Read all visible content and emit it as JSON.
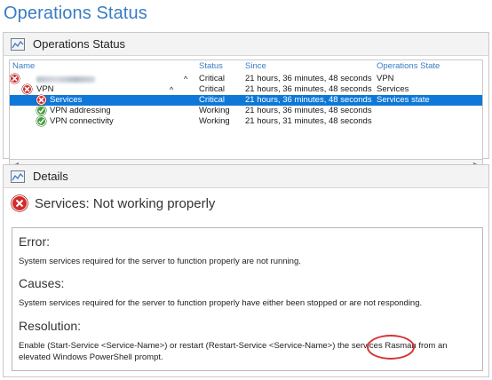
{
  "page": {
    "title": "Operations Status"
  },
  "operations_panel": {
    "title": "Operations Status",
    "columns": {
      "name": "Name",
      "status": "Status",
      "since": "Since",
      "state": "Operations State"
    },
    "rows": [
      {
        "name": "",
        "status": "Critical",
        "since": "21 hours, 36 minutes, 48 seconds",
        "state": "VPN",
        "icon": "error-icon"
      },
      {
        "name": "VPN",
        "status": "Critical",
        "since": "21 hours, 36 minutes, 48 seconds",
        "state": "Services",
        "icon": "error-icon"
      },
      {
        "name": "Services",
        "status": "Critical",
        "since": "21 hours, 36 minutes, 48 seconds",
        "state": "Services state",
        "icon": "error-icon",
        "selected": true
      },
      {
        "name": "VPN addressing",
        "status": "Working",
        "since": "21 hours, 36 minutes, 48 seconds",
        "state": "",
        "icon": "ok-icon"
      },
      {
        "name": "VPN connectivity",
        "status": "Working",
        "since": "21 hours, 31 minutes, 48 seconds",
        "state": "",
        "icon": "ok-icon"
      }
    ]
  },
  "details_panel": {
    "title": "Details",
    "heading": "Services: Not working properly",
    "error_label": "Error:",
    "error_text": "System services required for the server to function properly are not running.",
    "causes_label": "Causes:",
    "causes_text": "System services required for the server to function properly have either been stopped or are not responding.",
    "resolution_label": "Resolution:",
    "resolution_text": "Enable (Start-Service <Service-Name>) or restart (Restart-Service <Service-Name>) the services Rasman from an elevated Windows PowerShell prompt."
  },
  "colors": {
    "title_blue": "#3a7cc4",
    "selection_blue": "#0f78d7",
    "error_red": "#d42a2a",
    "ok_green": "#3f9e37",
    "annotation_red": "#d63434"
  }
}
